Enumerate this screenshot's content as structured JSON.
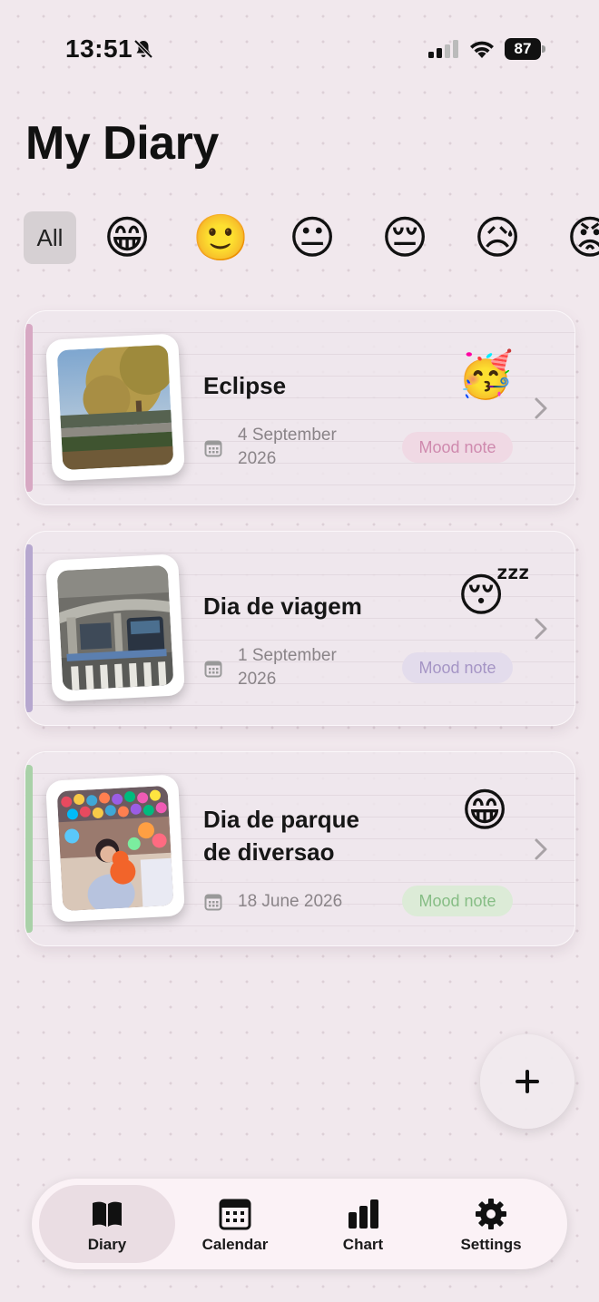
{
  "status_bar": {
    "time": "13:51",
    "battery": "87"
  },
  "page_title": "My Diary",
  "filters": {
    "all_label": "All",
    "moods": [
      {
        "name": "grinning",
        "emoji": "😁"
      },
      {
        "name": "smiling",
        "emoji": "🙂"
      },
      {
        "name": "neutral",
        "emoji": "😐"
      },
      {
        "name": "pensive",
        "emoji": "😔"
      },
      {
        "name": "sad",
        "emoji": "😥"
      },
      {
        "name": "angry",
        "emoji": "😡"
      }
    ]
  },
  "entries": [
    {
      "title": "Eclipse",
      "date_line1": "4 September",
      "date_line2": "2026",
      "badge": "Mood note",
      "emoji": "🥳",
      "accent_color": "#d7a8c3",
      "badge_bg": "#f0d9e4",
      "badge_color": "#cf8aae"
    },
    {
      "title": "Dia de viagem",
      "date_line1": "1 September",
      "date_line2": "2026",
      "badge": "Mood note",
      "emoji": "😴",
      "accent_color": "#b6a7cf",
      "badge_bg": "#e3dcec",
      "badge_color": "#a595c5"
    },
    {
      "title_line1": "Dia de parque",
      "title_line2": "de diversao",
      "date": "18 June 2026",
      "badge": "Mood note",
      "emoji": "😁",
      "accent_color": "#a9d1a8",
      "badge_bg": "#dcebd7",
      "badge_color": "#86bd85"
    }
  ],
  "tabs": [
    {
      "label": "Diary",
      "icon": "book-icon"
    },
    {
      "label": "Calendar",
      "icon": "calendar-icon"
    },
    {
      "label": "Chart",
      "icon": "bar-chart-icon"
    },
    {
      "label": "Settings",
      "icon": "gear-icon"
    }
  ],
  "add_icon": "plus-icon"
}
